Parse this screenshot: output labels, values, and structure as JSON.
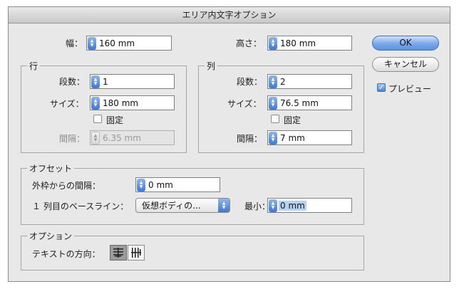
{
  "title": "エリア内文字オプション",
  "width": {
    "label": "幅：",
    "value": "160 mm"
  },
  "height": {
    "label": "高さ：",
    "value": "180 mm"
  },
  "rows": {
    "title": "行",
    "count_label": "段数：",
    "count_value": "1",
    "size_label": "サイズ：",
    "size_value": "180 mm",
    "fixed_label": "固定",
    "gutter_label": "間隔：",
    "gutter_value": "6.35 mm"
  },
  "columns": {
    "title": "列",
    "count_label": "段数：",
    "count_value": "2",
    "size_label": "サイズ：",
    "size_value": "76.5 mm",
    "fixed_label": "固定",
    "gutter_label": "間隔：",
    "gutter_value": "7 mm"
  },
  "offset": {
    "title": "オフセット",
    "inset_label": "外枠からの間隔：",
    "inset_value": "0 mm",
    "baseline_label": "１ 列目のベースライン：",
    "baseline_value": "仮想ボディの...",
    "min_label": "最小：",
    "min_value": "0 mm"
  },
  "options": {
    "title": "オプション",
    "direction_label": "テキストの方向："
  },
  "buttons": {
    "ok": "OK",
    "cancel": "キャンセル"
  },
  "preview": {
    "label": "プレビュー",
    "checked": true
  },
  "colors": {
    "accent": "#3d79d6",
    "selection": "#b5d1f5"
  }
}
